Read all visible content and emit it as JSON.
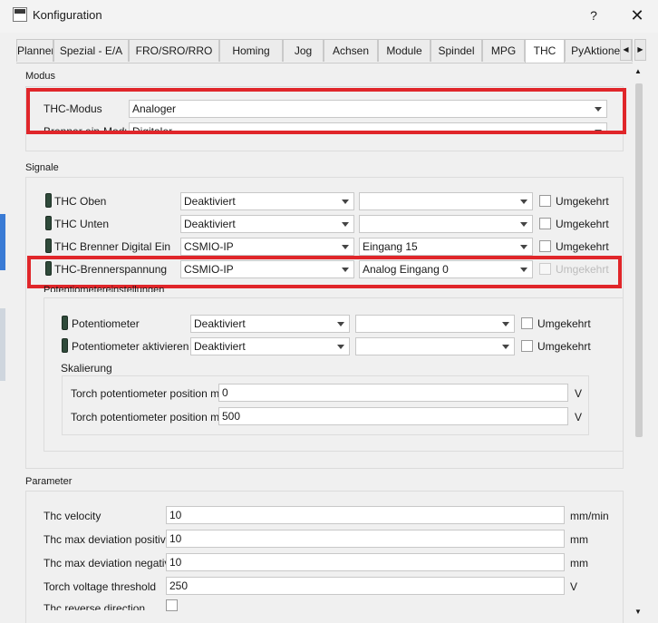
{
  "window": {
    "title": "Konfiguration",
    "help": "?",
    "close": "✕"
  },
  "tabs": [
    {
      "label": "Planner"
    },
    {
      "label": "Spezial - E/A"
    },
    {
      "label": "FRO/SRO/RRO"
    },
    {
      "label": "Homing"
    },
    {
      "label": "Jog"
    },
    {
      "label": "Achsen"
    },
    {
      "label": "Module"
    },
    {
      "label": "Spindel"
    },
    {
      "label": "MPG"
    },
    {
      "label": "THC"
    },
    {
      "label": "PyAktionen"
    }
  ],
  "modus": {
    "title": "Modus",
    "thc_mode_label": "THC-Modus",
    "thc_mode_value": "Analoger",
    "burner_mode_label": "Brenner ein-Modus",
    "burner_mode_value": "Digitaler"
  },
  "signals": {
    "title": "Signale",
    "inverted_label": "Umgekehrt",
    "rows": [
      {
        "label": "THC Oben",
        "source": "Deaktiviert",
        "input": ""
      },
      {
        "label": "THC Unten",
        "source": "Deaktiviert",
        "input": ""
      },
      {
        "label": "THC Brenner Digital Ein",
        "source": "CSMIO-IP",
        "input": "Eingang 15"
      },
      {
        "label": "THC-Brennerspannung",
        "source": "CSMIO-IP",
        "input": "Analog Eingang 0"
      }
    ]
  },
  "pot": {
    "title": "Potentiometereinstellungen",
    "rows": [
      {
        "label": "Potentiometer",
        "source": "Deaktiviert",
        "input": ""
      },
      {
        "label": "Potentiometer aktivieren",
        "source": "Deaktiviert",
        "input": ""
      }
    ],
    "scaling_title": "Skalierung",
    "min_label": "Torch potentiometer position min",
    "min_value": "0",
    "max_label": "Torch potentiometer position max",
    "max_value": "500",
    "unit": "V"
  },
  "params": {
    "title": "Parameter",
    "rows": [
      {
        "label": "Thc velocity",
        "value": "10",
        "unit": "mm/min"
      },
      {
        "label": "Thc max deviation positive",
        "value": "10",
        "unit": "mm"
      },
      {
        "label": "Thc max deviation negative",
        "value": "10",
        "unit": "mm"
      },
      {
        "label": "Torch voltage threshold",
        "value": "250",
        "unit": "V"
      },
      {
        "label": "Thc reverse direction"
      }
    ]
  },
  "colors": {
    "highlight": "#e0262a",
    "led": "#2f4a3a",
    "accent": "#ffffff"
  }
}
